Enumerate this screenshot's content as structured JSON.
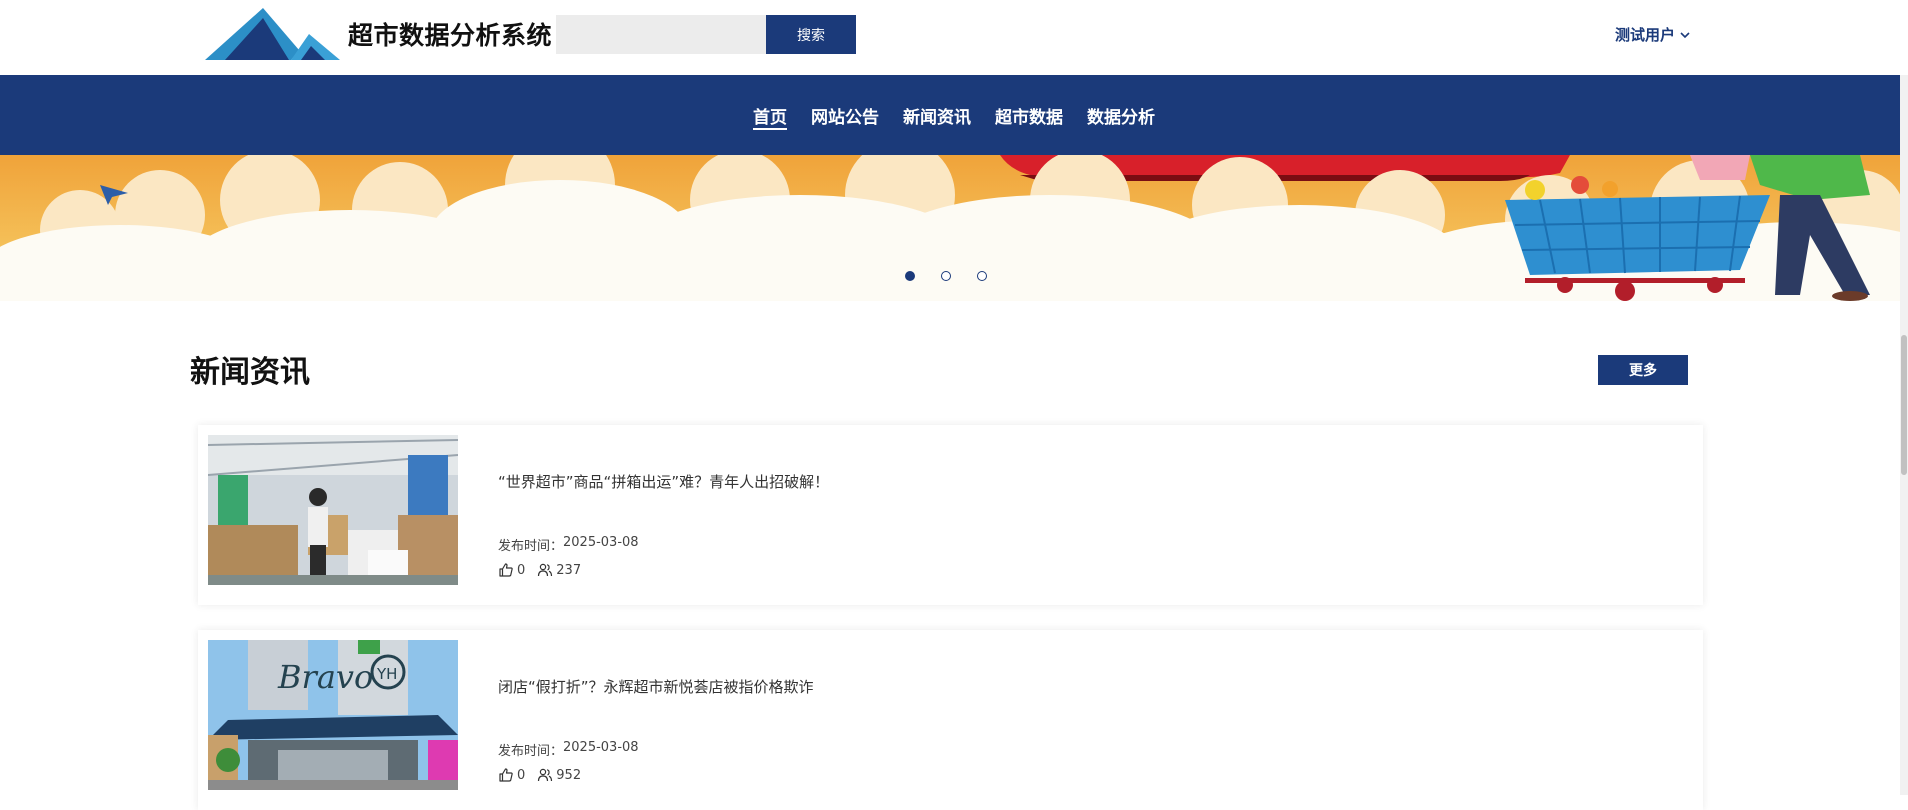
{
  "header": {
    "site_title": "超市数据分析系统",
    "search_placeholder": "",
    "search_button": "搜索",
    "user_name": "测试用户",
    "user_menu_icon": "chevron-down-icon"
  },
  "nav": {
    "items": [
      {
        "label": "首页",
        "active": true
      },
      {
        "label": "网站公告",
        "active": false
      },
      {
        "label": "新闻资讯",
        "active": false
      },
      {
        "label": "超市数据",
        "active": false
      },
      {
        "label": "数据分析",
        "active": false
      }
    ]
  },
  "carousel": {
    "slide_count": 3,
    "active_index": 0
  },
  "news_section": {
    "title": "新闻资讯",
    "more_button": "更多",
    "date_label": "发布时间：",
    "items": [
      {
        "title": "“世界超市”商品“拼箱出运”难？青年人出招破解！",
        "date": "2025-03-08",
        "likes": "0",
        "views": "237"
      },
      {
        "title": "闭店“假打折”？永辉超市新悦荟店被指价格欺诈",
        "date": "2025-03-08",
        "likes": "0",
        "views": "952"
      }
    ]
  },
  "colors": {
    "primary": "#1b3a7a",
    "search_bg": "#ececec"
  },
  "icons": {
    "like": "thumbs-up-icon",
    "views": "users-icon"
  }
}
